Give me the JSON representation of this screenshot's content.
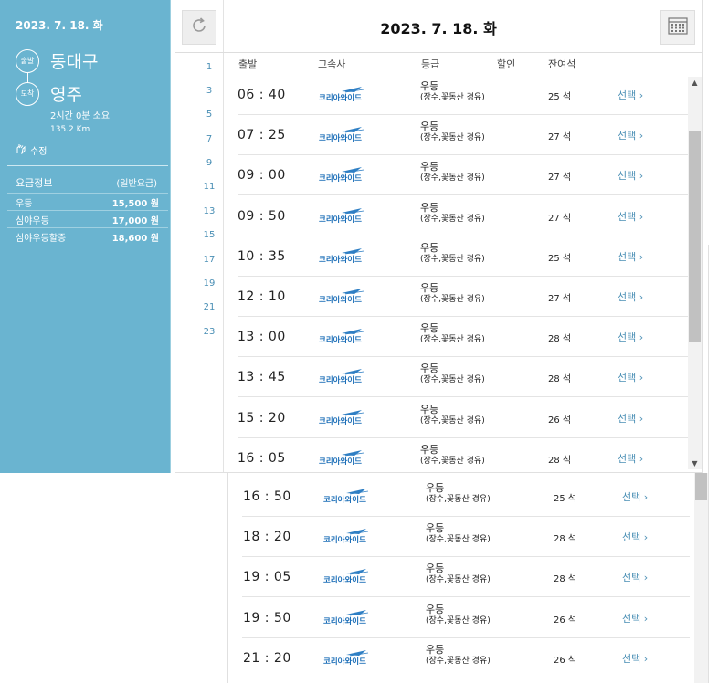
{
  "summary": {
    "date": "2023. 7. 18. 화",
    "departure_label": "출발",
    "departure": "동대구",
    "arrival_label": "도착",
    "arrival": "영주",
    "duration": "2시간 0분 소요",
    "distance": "135.2 Km",
    "edit_label": "수정",
    "fare_title": "요금정보",
    "fare_sub": "(일반요금)",
    "fares": [
      {
        "grade": "우등",
        "amount": "15,500 원"
      },
      {
        "grade": "심야우등",
        "amount": "17,000 원"
      },
      {
        "grade": "심야우등할증",
        "amount": "18,600 원"
      }
    ]
  },
  "header": {
    "date": "2023. 7. 18. 화"
  },
  "hour_index": [
    "1",
    "3",
    "5",
    "7",
    "9",
    "11",
    "13",
    "15",
    "17",
    "19",
    "21",
    "23"
  ],
  "columns": {
    "departure": "출발",
    "company": "고속사",
    "grade": "등급",
    "discount": "할인",
    "seats": "잔여석"
  },
  "company_name": "코리아와이드",
  "buses": [
    {
      "time": "06 : 40",
      "grade": "우등",
      "via": "(장수,꽃동산 경유)",
      "seats": "25 석",
      "select": "선택"
    },
    {
      "time": "07 : 25",
      "grade": "우등",
      "via": "(장수,꽃동산 경유)",
      "seats": "27 석",
      "select": "선택"
    },
    {
      "time": "09 : 00",
      "grade": "우등",
      "via": "(장수,꽃동산 경유)",
      "seats": "27 석",
      "select": "선택"
    },
    {
      "time": "09 : 50",
      "grade": "우등",
      "via": "(장수,꽃동산 경유)",
      "seats": "27 석",
      "select": "선택"
    },
    {
      "time": "10 : 35",
      "grade": "우등",
      "via": "(장수,꽃동산 경유)",
      "seats": "25 석",
      "select": "선택"
    },
    {
      "time": "12 : 10",
      "grade": "우등",
      "via": "(장수,꽃동산 경유)",
      "seats": "27 석",
      "select": "선택"
    },
    {
      "time": "13 : 00",
      "grade": "우등",
      "via": "(장수,꽃동산 경유)",
      "seats": "28 석",
      "select": "선택"
    },
    {
      "time": "13 : 45",
      "grade": "우등",
      "via": "(장수,꽃동산 경유)",
      "seats": "28 석",
      "select": "선택"
    },
    {
      "time": "15 : 20",
      "grade": "우등",
      "via": "(장수,꽃동산 경유)",
      "seats": "26 석",
      "select": "선택"
    },
    {
      "time": "16 : 05",
      "grade": "우등",
      "via": "(장수,꽃동산 경유)",
      "seats": "28 석",
      "select": "선택"
    }
  ],
  "buses_continued": [
    {
      "time": "16 : 50",
      "grade": "우등",
      "via": "(장수,꽃동산 경유)",
      "seats": "25 석",
      "select": "선택"
    },
    {
      "time": "18 : 20",
      "grade": "우등",
      "via": "(장수,꽃동산 경유)",
      "seats": "28 석",
      "select": "선택"
    },
    {
      "time": "19 : 05",
      "grade": "우등",
      "via": "(장수,꽃동산 경유)",
      "seats": "28 석",
      "select": "선택"
    },
    {
      "time": "19 : 50",
      "grade": "우등",
      "via": "(장수,꽃동산 경유)",
      "seats": "26 석",
      "select": "선택"
    },
    {
      "time": "21 : 20",
      "grade": "우등",
      "via": "(장수,꽃동산 경유)",
      "seats": "26 석",
      "select": "선택"
    }
  ],
  "colors": {
    "panel": "#6ab4d0",
    "link": "#4a8fb5"
  },
  "icons": {
    "refresh": "refresh-icon",
    "calendar": "calendar-icon",
    "edit": "edit-hand-icon",
    "select_arrow": "chevron-right-icon"
  }
}
